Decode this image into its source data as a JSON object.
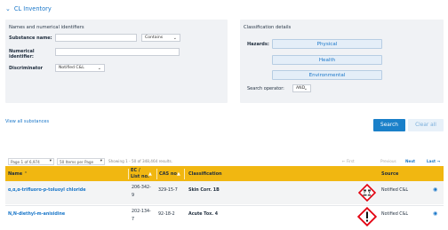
{
  "section": {
    "title": "CL Inventory"
  },
  "names_panel": {
    "title": "Names and numerical identifiers",
    "substance_label": "Substance name:",
    "substance_value": "",
    "match_mode": "Contains",
    "numerical_label_1": "Numerical",
    "numerical_label_2": "identifier:",
    "numerical_value": "",
    "discriminator_label": "Discriminator",
    "discriminator_value": "Notified C&L"
  },
  "class_panel": {
    "title": "Classification details",
    "hazards_label": "Hazards:",
    "hazards": [
      "Physical",
      "Health",
      "Environmental"
    ],
    "search_operator_label": "Search operator:",
    "search_operator_value": "AND"
  },
  "links": {
    "view_all": "View all substances"
  },
  "buttons": {
    "search": "Search",
    "clear": "Clear all"
  },
  "pager": {
    "page_select": "Page 1 of 6,974",
    "per_page": "50 Items per Page",
    "showing": "Showing 1 - 50 of 348,464 results.",
    "first": "← First",
    "previous": "Previous",
    "next": "Next",
    "last": "Last →"
  },
  "table": {
    "headers": {
      "name": "Name",
      "ec_1": "EC /",
      "ec_2": "List no.",
      "cas": "CAS no.",
      "classification": "Classification",
      "source": "Source"
    },
    "rows": [
      {
        "name": "α,α,α-trifluoro-p-toluoyl chloride",
        "ec_1": "206-342-",
        "ec_2": "9",
        "cas": "329-15-7",
        "classification": "Skin Corr. 1B",
        "pictogram": "corrosion-pictogram",
        "source": "Notified C&L"
      },
      {
        "name": "N,N-diethyl-m-anisidine",
        "ec_1": "202-134-",
        "ec_2": "7",
        "cas": "92-18-2",
        "classification": "Acute Tox. 4",
        "pictogram": "exclamation-pictogram",
        "source": "Notified C&L"
      }
    ]
  },
  "colors": {
    "accent": "#1a77c9",
    "header_row": "#f1b711",
    "panel_bg": "#f0f2f5",
    "ghs_red": "#e3000f"
  }
}
